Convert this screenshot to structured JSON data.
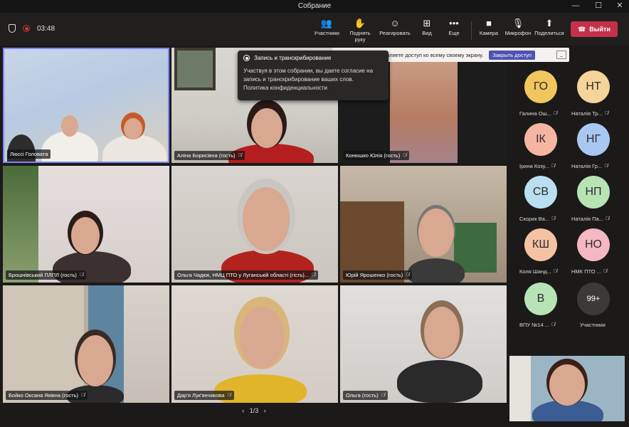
{
  "window": {
    "title": "Собрание",
    "minimize": "—",
    "maximize": "☐",
    "close": "✕"
  },
  "toolbar": {
    "timer": "03:48",
    "buttons": [
      {
        "label": "Участники",
        "icon": "people-icon",
        "glyph": "👥"
      },
      {
        "label": "Поднять руку",
        "icon": "raise-hand-icon",
        "glyph": "✋"
      },
      {
        "label": "Реагировать",
        "icon": "emoji-icon",
        "glyph": "☺"
      },
      {
        "label": "Вид",
        "icon": "grid-view-icon",
        "glyph": "⊞"
      },
      {
        "label": "Еще",
        "icon": "more-icon",
        "glyph": "•••"
      },
      {
        "label": "Камера",
        "icon": "camera-icon",
        "glyph": "■"
      },
      {
        "label": "Микрофон",
        "icon": "microphone-muted-icon",
        "glyph": "🎙"
      },
      {
        "label": "Поделиться",
        "icon": "share-icon",
        "glyph": "⬆"
      }
    ],
    "leave": {
      "label": "Выйти",
      "glyph": "☎"
    }
  },
  "banner": {
    "text": "Вы предоставляете доступ ко всему своему экрану.",
    "stop_label": "Закрыть доступ",
    "min_label": "_"
  },
  "recording_popup": {
    "title": "Запись и транскрибирование",
    "body": "Участвуя в этом собрании, вы даете согласие на запись и транскрибирование ваших слов.",
    "link": "Политика конфиденциальности"
  },
  "tiles": [
    {
      "name": "Люссі Головата"
    },
    {
      "name": "Аліна Борисівна (гость)"
    },
    {
      "name": "Конюшко Юлія (гость)"
    },
    {
      "name": "Брошнівський ПЛПЛ (гость)"
    },
    {
      "name": "Ольга Чадюк, НМЦ ПТО у Луганській області (гість)..."
    },
    {
      "name": "Юрій Ярошенко (гость)"
    },
    {
      "name": "Бойко Оксана Яківна (гость)"
    },
    {
      "name": "Дар'я Лук'янчикова"
    },
    {
      "name": "Ольга (гость)"
    }
  ],
  "attendees": [
    {
      "initials": "ГО",
      "name": "Галина Ош...",
      "color": "#f2c65e"
    },
    {
      "initials": "НТ",
      "name": "Наталія Тр...",
      "color": "#f5d49b"
    },
    {
      "initials": "ІК",
      "name": "Ірина Козу...",
      "color": "#f4b6a2"
    },
    {
      "initials": "НГ",
      "name": "Наталія Гр...",
      "color": "#a9c7f0"
    },
    {
      "initials": "СВ",
      "name": "Скорик Ва...",
      "color": "#b9dff0"
    },
    {
      "initials": "НП",
      "name": "Наталія Па...",
      "color": "#b7e3b5"
    },
    {
      "initials": "КШ",
      "name": "Коля Шанд...",
      "color": "#f5c3a3"
    },
    {
      "initials": "НО",
      "name": "НМК ПТО ...",
      "color": "#f3b8c1"
    },
    {
      "initials": "В",
      "name": "ВПУ №14 ...",
      "color": "#b7e3b5"
    }
  ],
  "participants_more": {
    "count": "99+",
    "label": "Участники"
  },
  "pager": {
    "prev": "‹",
    "page": "1/3",
    "next": "›"
  }
}
